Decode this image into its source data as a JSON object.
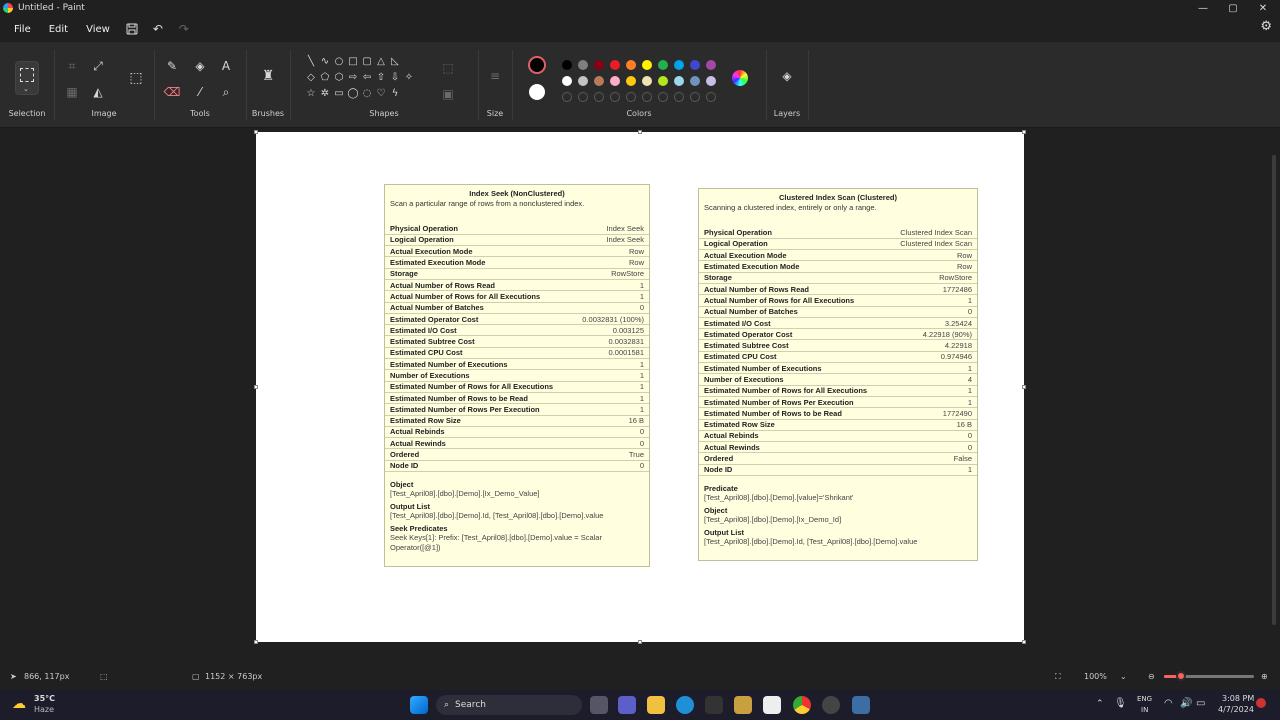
{
  "window": {
    "title": "Untitled - Paint",
    "minimize": "—",
    "maximize": "▢",
    "close": "✕"
  },
  "menu": {
    "file": "File",
    "edit": "Edit",
    "view": "View"
  },
  "ribbon": {
    "groups": {
      "selection": "Selection",
      "image": "Image",
      "tools": "Tools",
      "brushes": "Brushes",
      "shapes": "Shapes",
      "size": "Size",
      "colors": "Colors",
      "layers": "Layers"
    },
    "primary_color": "#000000",
    "secondary_color": "#ffffff",
    "palette_row1": [
      "#000000",
      "#7f7f7f",
      "#880015",
      "#ed1c24",
      "#ff7f27",
      "#fff200",
      "#22b14c",
      "#00a2e8",
      "#3f48cc",
      "#a349a4"
    ],
    "palette_row2": [
      "#ffffff",
      "#c3c3c3",
      "#b97a57",
      "#ffaec9",
      "#ffc90e",
      "#efe4b0",
      "#b5e61d",
      "#99d9ea",
      "#7092be",
      "#c8bfe7"
    ]
  },
  "left_tooltip": {
    "title": "Index Seek (NonClustered)",
    "description": "Scan a particular range of rows from a nonclustered index.",
    "rows": [
      {
        "k": "Physical Operation",
        "v": "Index Seek"
      },
      {
        "k": "Logical Operation",
        "v": "Index Seek"
      },
      {
        "k": "Actual Execution Mode",
        "v": "Row"
      },
      {
        "k": "Estimated Execution Mode",
        "v": "Row"
      },
      {
        "k": "Storage",
        "v": "RowStore"
      },
      {
        "k": "Actual Number of Rows Read",
        "v": "1"
      },
      {
        "k": "Actual Number of Rows for All Executions",
        "v": "1"
      },
      {
        "k": "Actual Number of Batches",
        "v": "0"
      },
      {
        "k": "Estimated Operator Cost",
        "v": "0.0032831 (100%)"
      },
      {
        "k": "Estimated I/O Cost",
        "v": "0.003125"
      },
      {
        "k": "Estimated Subtree Cost",
        "v": "0.0032831"
      },
      {
        "k": "Estimated CPU Cost",
        "v": "0.0001581"
      },
      {
        "k": "Estimated Number of Executions",
        "v": "1"
      },
      {
        "k": "Number of Executions",
        "v": "1"
      },
      {
        "k": "Estimated Number of Rows for All Executions",
        "v": "1"
      },
      {
        "k": "Estimated Number of Rows to be Read",
        "v": "1"
      },
      {
        "k": "Estimated Number of Rows Per Execution",
        "v": "1"
      },
      {
        "k": "Estimated Row Size",
        "v": "16 B"
      },
      {
        "k": "Actual Rebinds",
        "v": "0"
      },
      {
        "k": "Actual Rewinds",
        "v": "0"
      },
      {
        "k": "Ordered",
        "v": "True"
      },
      {
        "k": "Node ID",
        "v": "0"
      }
    ],
    "object_label": "Object",
    "object_value": "[Test_April08].[dbo].[Demo].[Ix_Demo_Value]",
    "output_label": "Output List",
    "output_value": "[Test_April08].[dbo].[Demo].Id, [Test_April08].[dbo].[Demo].value",
    "seek_label": "Seek Predicates",
    "seek_value": "Seek Keys[1]: Prefix: [Test_April08].[dbo].[Demo].value = Scalar Operator([@1])"
  },
  "right_tooltip": {
    "title": "Clustered Index Scan (Clustered)",
    "description": "Scanning a clustered index, entirely or only a range.",
    "rows": [
      {
        "k": "Physical Operation",
        "v": "Clustered Index Scan"
      },
      {
        "k": "Logical Operation",
        "v": "Clustered Index Scan"
      },
      {
        "k": "Actual Execution Mode",
        "v": "Row"
      },
      {
        "k": "Estimated Execution Mode",
        "v": "Row"
      },
      {
        "k": "Storage",
        "v": "RowStore"
      },
      {
        "k": "Actual Number of Rows Read",
        "v": "1772486"
      },
      {
        "k": "Actual Number of Rows for All Executions",
        "v": "1"
      },
      {
        "k": "Actual Number of Batches",
        "v": "0"
      },
      {
        "k": "Estimated I/O Cost",
        "v": "3.25424"
      },
      {
        "k": "Estimated Operator Cost",
        "v": "4.22918 (90%)"
      },
      {
        "k": "Estimated Subtree Cost",
        "v": "4.22918"
      },
      {
        "k": "Estimated CPU Cost",
        "v": "0.974946"
      },
      {
        "k": "Estimated Number of Executions",
        "v": "1"
      },
      {
        "k": "Number of Executions",
        "v": "4"
      },
      {
        "k": "Estimated Number of Rows for All Executions",
        "v": "1"
      },
      {
        "k": "Estimated Number of Rows Per Execution",
        "v": "1"
      },
      {
        "k": "Estimated Number of Rows to be Read",
        "v": "1772490"
      },
      {
        "k": "Estimated Row Size",
        "v": "16 B"
      },
      {
        "k": "Actual Rebinds",
        "v": "0"
      },
      {
        "k": "Actual Rewinds",
        "v": "0"
      },
      {
        "k": "Ordered",
        "v": "False"
      },
      {
        "k": "Node ID",
        "v": "1"
      }
    ],
    "predicate_label": "Predicate",
    "predicate_value": "[Test_April08].[dbo].[Demo].[value]='Shrikant'",
    "object_label": "Object",
    "object_value": "[Test_April08].[dbo].[Demo].[Ix_Demo_Id]",
    "output_label": "Output List",
    "output_value": "[Test_April08].[dbo].[Demo].Id, [Test_April08].[dbo].[Demo].value"
  },
  "status": {
    "cursor_pos": "866, 117px",
    "canvas_size": "1152 × 763px",
    "zoom": "100%"
  },
  "taskbar": {
    "weather_temp": "35°C",
    "weather_desc": "Haze",
    "search_placeholder": "Search",
    "lang_top": "ENG",
    "lang_bottom": "IN",
    "time": "3:08 PM",
    "date": "4/7/2024"
  }
}
